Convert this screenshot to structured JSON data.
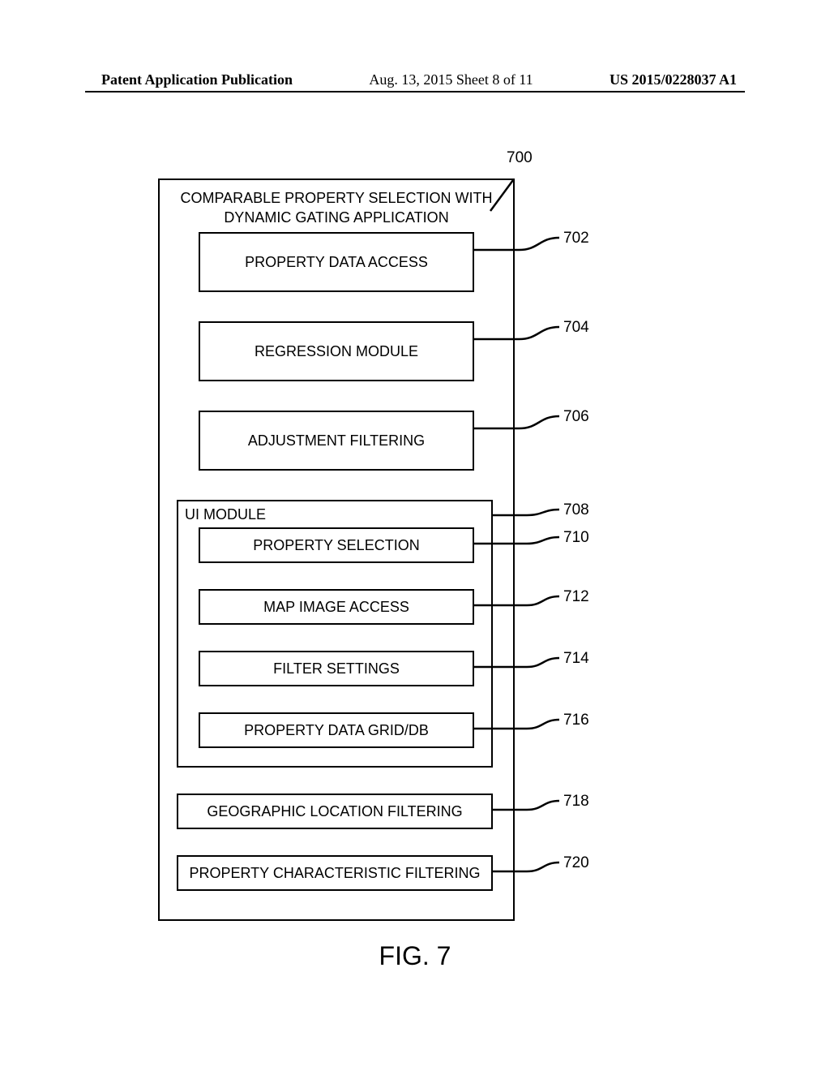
{
  "header": {
    "left": "Patent Application Publication",
    "center": "Aug. 13, 2015  Sheet 8 of 11",
    "right": "US 2015/0228037 A1"
  },
  "main": {
    "title_line1": "COMPARABLE PROPERTY SELECTION WITH",
    "title_line2": "DYNAMIC GATING APPLICATION"
  },
  "blocks": {
    "b702": "PROPERTY DATA ACCESS",
    "b704": "REGRESSION MODULE",
    "b706": "ADJUSTMENT FILTERING",
    "b708_label": "UI MODULE",
    "b710": "PROPERTY SELECTION",
    "b712": "MAP IMAGE ACCESS",
    "b714": "FILTER SETTINGS",
    "b716": "PROPERTY DATA GRID/DB",
    "b718": "GEOGRAPHIC LOCATION FILTERING",
    "b720": "PROPERTY CHARACTERISTIC FILTERING"
  },
  "labels": {
    "l700": "700",
    "l702": "702",
    "l704": "704",
    "l706": "706",
    "l708": "708",
    "l710": "710",
    "l712": "712",
    "l714": "714",
    "l716": "716",
    "l718": "718",
    "l720": "720"
  },
  "fig_caption": "FIG. 7"
}
